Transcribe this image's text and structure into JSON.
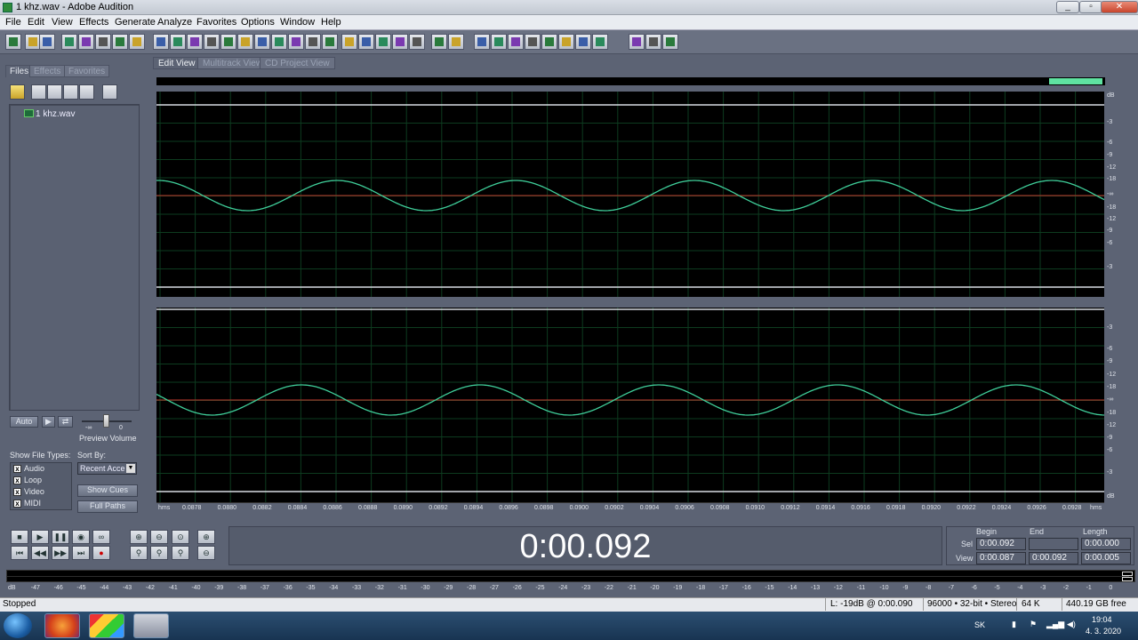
{
  "window": {
    "title": "1 khz.wav - Adobe Audition",
    "min": "0",
    "max": "1",
    "close": "r"
  },
  "menu": [
    "File",
    "Edit",
    "View",
    "Effects",
    "Generate",
    "Analyze",
    "Favorites",
    "Options",
    "Window",
    "Help"
  ],
  "left": {
    "tabs": [
      "Files",
      "Effects",
      "Favorites"
    ],
    "file": "1 khz.wav",
    "auto_label": "Auto",
    "preview_volume": "Preview Volume",
    "vol_min": "-∞",
    "vol_max": "0",
    "show_file_types": "Show File Types:",
    "sort_by": "Sort By:",
    "types": [
      "Audio",
      "Loop",
      "Video",
      "MIDI"
    ],
    "sort_value": "Recent Acce",
    "show_cues": "Show Cues",
    "full_paths": "Full Paths"
  },
  "view_tabs": [
    "Edit View",
    "Multitrack View",
    "CD Project View"
  ],
  "db_labels_top": [
    "dB",
    "-3",
    "-6",
    "-9",
    "-12",
    "-18",
    "-∞",
    "-18",
    "-12",
    "-9",
    "-6",
    "-3"
  ],
  "db_labels_bottom": [
    "-3",
    "-6",
    "-9",
    "-12",
    "-18",
    "-∞",
    "-18",
    "-12",
    "-9",
    "-6",
    "-3",
    "dB"
  ],
  "time_ruler": {
    "unit": "hms",
    "ticks": [
      "0.0878",
      "0.0880",
      "0.0882",
      "0.0884",
      "0.0886",
      "0.0888",
      "0.0890",
      "0.0892",
      "0.0894",
      "0.0896",
      "0.0898",
      "0.0900",
      "0.0902",
      "0.0904",
      "0.0906",
      "0.0908",
      "0.0910",
      "0.0912",
      "0.0914",
      "0.0916",
      "0.0918",
      "0.0920",
      "0.0922",
      "0.0924",
      "0.0926",
      "0.0928"
    ]
  },
  "time_display": "0:00.092",
  "selection": {
    "hdr_begin": "Begin",
    "hdr_end": "End",
    "hdr_length": "Length",
    "sel_label": "Sel",
    "view_label": "View",
    "sel_begin": "0:00.092",
    "sel_end": "",
    "sel_length": "0:00.000",
    "view_begin": "0:00.087",
    "view_end": "0:00.092",
    "view_length": "0:00.005"
  },
  "meter_labels": [
    "dB",
    "-47",
    "-46",
    "-45",
    "-44",
    "-43",
    "-42",
    "-41",
    "-40",
    "-39",
    "-38",
    "-37",
    "-36",
    "-35",
    "-34",
    "-33",
    "-32",
    "-31",
    "-30",
    "-29",
    "-28",
    "-27",
    "-26",
    "-25",
    "-24",
    "-23",
    "-22",
    "-21",
    "-20",
    "-19",
    "-18",
    "-17",
    "-16",
    "-15",
    "-14",
    "-13",
    "-12",
    "-11",
    "-10",
    "-9",
    "-8",
    "-7",
    "-6",
    "-5",
    "-4",
    "-3",
    "-2",
    "-1",
    "0"
  ],
  "status": {
    "state": "Stopped",
    "level": "L: -19dB @  0:00.090",
    "format": "96000 • 32-bit • Stereo",
    "size": "64 K",
    "free": "440.19 GB free"
  },
  "taskbar": {
    "lang": "SK",
    "time": "19:04",
    "date": "4. 3. 2020"
  },
  "colors": {
    "waveform": "#3fcf9a",
    "centerline": "#c0392b",
    "grid": "#0d3b1f",
    "overview_sel": "#5fe3a1"
  }
}
